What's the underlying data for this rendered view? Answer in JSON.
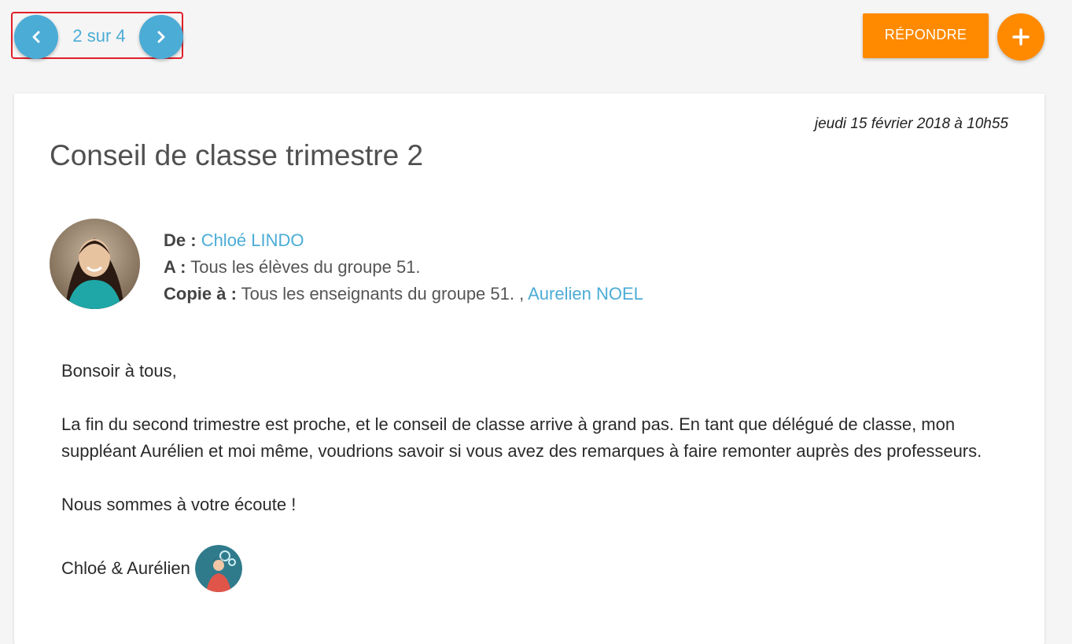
{
  "pager": {
    "text": "2 sur 4",
    "prev_icon": "chevron-left-icon",
    "next_icon": "chevron-right-icon"
  },
  "toolbar": {
    "reply_label": "RÉPONDRE",
    "new_icon": "plus-icon"
  },
  "message": {
    "date": "jeudi 15 février 2018 à 10h55",
    "title": "Conseil de classe trimestre 2",
    "from_label": "De :",
    "from_value": "Chloé LINDO",
    "to_label": "A :",
    "to_value": "Tous les élèves du groupe 51.",
    "cc_label": "Copie à :",
    "cc_value": "Tous les enseignants du groupe 51. ,",
    "cc_link": "Aurelien NOEL",
    "body": {
      "greeting": "Bonsoir à tous,",
      "paragraph": "La fin du second trimestre est proche, et le conseil de classe arrive à grand pas. En tant que délégué de classe, mon suppléant Aurélien et moi même, voudrions savoir si vous avez des remarques à faire remonter auprès des professeurs.",
      "closing": "Nous sommes à votre écoute !",
      "signature": "Chloé & Aurélien"
    }
  },
  "colors": {
    "accent_blue": "#4bacd6",
    "accent_orange": "#ff8a00",
    "highlight_red": "#e0202a"
  }
}
